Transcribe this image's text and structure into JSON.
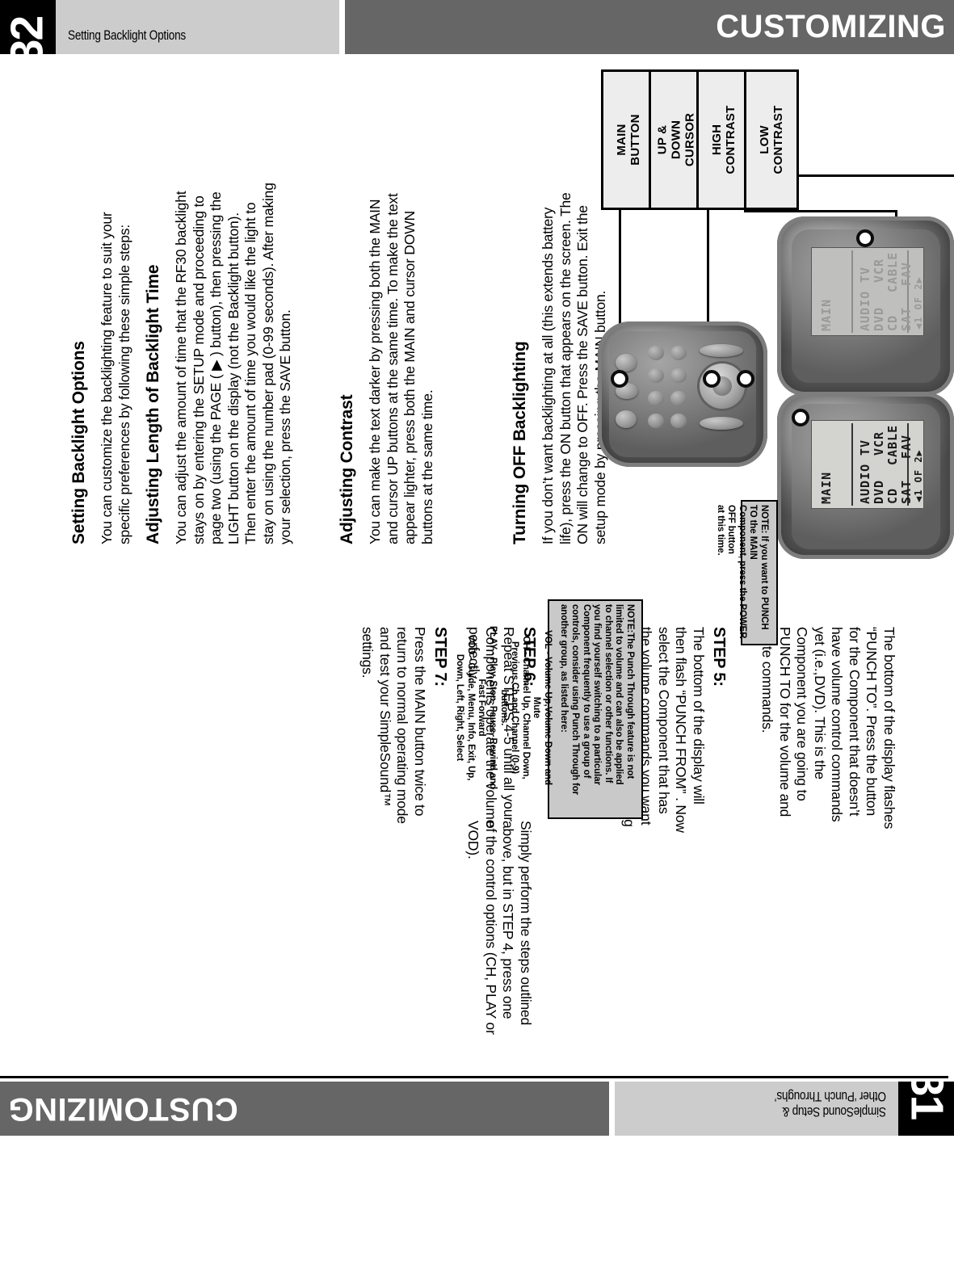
{
  "page32": {
    "page_number": "32",
    "header_subtitle": "Setting Backlight Options",
    "header_title": "CUSTOMIZING",
    "sections": [
      {
        "heading": "Setting Backlight Options",
        "body": "You can customize the backlighting feature to suit your\nspecific preferences by following these simple steps:"
      },
      {
        "heading": "Adjusting Length of Backlight Time",
        "body": "You can adjust the amount of time that the RF30 backlight\nstays on by entering the SETUP mode and proceeding to\npage two (using the PAGE ( ▶ ) button), then pressing the\nLIGHT button on the display (not the Backlight button).\nThen enter the amount of time you would like the light to\nstay on using the number pad (0-99 seconds). After making\nyour selection, press the SAVE button."
      },
      {
        "heading": "Adjusting Contrast",
        "body": "You can make the text darker by pressing both the MAIN\nand cursor UP buttons at the same time. To make the text\nappear lighter, press both the MAIN and cursor DOWN\nbuttons at the same time."
      },
      {
        "heading": "Turning OFF Backlighting",
        "body": "If you don’t want backlighting at all (this extends battery\nlife), press the ON button that appears on the screen. The\nON will change to OFF. Press the SAVE button. Exit the\nsetup mode by pressing the MAIN button."
      }
    ],
    "callouts": [
      {
        "label": "MAIN\nBUTTON"
      },
      {
        "label": "UP & DOWN\nCURSOR"
      },
      {
        "label": "HIGH\nCONTRAST"
      },
      {
        "label": "LOW\nCONTRAST"
      }
    ],
    "lcd_low": {
      "title": "MAIN",
      "rows": [
        [
          "AUDIO",
          "TV"
        ],
        [
          "DVD",
          "VCR"
        ],
        [
          "CD",
          "CABLE"
        ],
        [
          "SAT",
          "FAV"
        ]
      ],
      "footer": "◀1 OF 2▶"
    },
    "lcd_high": {
      "title": "MAIN",
      "rows": [
        [
          "AUDIO",
          "TV"
        ],
        [
          "DVD",
          "VCR"
        ],
        [
          "CD",
          "CABLE"
        ],
        [
          "SAT",
          "FAV"
        ]
      ],
      "footer": "◀1 OF 2▶"
    }
  },
  "page31": {
    "page_number": "31",
    "header_subtitle": "SimpleSound Setup &\nOther ‘Punch Throughs’",
    "header_title": "CUSTOMIZING",
    "intro": "The bottom of the display flashes\n“PUNCH TO”. Press the button\nfor the Component that doesn’t\nhave volume control commands\nyet (i.e.,DVD). This is the\nComponent you are going to\nPUNCH TO for the volume and\nmute commands.",
    "note_small": "NOTE: If you want to PUNCH TO the MAIN\nComponent, press the POWER OFF button\nat this time.",
    "steps": [
      {
        "label": "STEP 5:",
        "body": "The bottom of the display will\nthen flash “PUNCH FROM” . Now\nselect the Component that has\nthe volume commands you want\nto use (i.e., TV for systems using\nthe TV speakers, AUDIO for\nsystems with surround sound\nreceivers). The bottom of the\ndisplay will flash “SAVED” ."
      },
      {
        "label": "STEP 6:",
        "body": "Repeat STEPS 4-5 until all your\nComponents operate the volume\nperfectly."
      },
      {
        "label": "STEP 7:",
        "body": "Press the MAIN button twice to\nreturn to normal operating mode\nand test your SimpleSound™\nsettings."
      }
    ],
    "note_large_intro": "NOTE:The Punch Through feature is not\nlimited to volume and can also be applied\nto channel selection or other functions. If\nyou find yourself switching to a particular\nComponent frequently to use a group of\ncontrols, consider using Punch Through for\nanother group, as listed here:",
    "note_large_list": "VOL - Volume Up,Volume Down and\nMute\nCH -  Channel Up, Channel Down,\nPrevious Ch and Channel (0-9)\nbuttons.\nPLAY - Play, Stop, Pause, Rewind and\nFast Forward\nVOD - Guide, Menu, Info, Exit, Up,\nDown, Left, Right, Select",
    "closing": "Simply perform the steps outlined\nabove, but in STEP 4, press one\nof the control options (CH, PLAY or\nVOD)."
  },
  "colors": {
    "header_dark": "#666666",
    "header_light": "#cccccc",
    "black": "#000000",
    "note_bg": "#c9c9c9",
    "callout_bg": "#ededed"
  }
}
